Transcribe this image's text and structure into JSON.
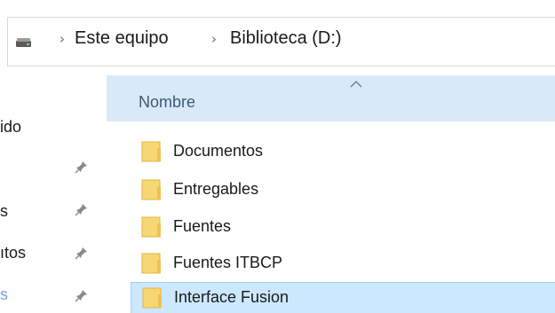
{
  "address_bar": {
    "drive_icon": "drive-icon",
    "breadcrumbs": [
      "Este equipo",
      "Biblioteca (D:)"
    ],
    "separator": "›"
  },
  "nav_pane": {
    "items": [
      {
        "label": "ido",
        "pinned": false
      },
      {
        "label": "",
        "pinned": true
      },
      {
        "label": "s",
        "pinned": true
      },
      {
        "label": "ıtos",
        "pinned": true
      },
      {
        "label": "s",
        "pinned": true
      }
    ]
  },
  "columns": {
    "name_header": "Nombre",
    "sort_indicator": "caret-up-icon"
  },
  "files": [
    {
      "name": "Documentos",
      "type": "folder",
      "selected": false
    },
    {
      "name": "Entregables",
      "type": "folder",
      "selected": false
    },
    {
      "name": "Fuentes",
      "type": "folder",
      "selected": false
    },
    {
      "name": "Fuentes ITBCP",
      "type": "folder",
      "selected": false
    },
    {
      "name": "Interface Fusion",
      "type": "folder",
      "selected": true
    }
  ],
  "colors": {
    "header_bg": "#d9e9f7",
    "selection_bg": "#cce8ff",
    "selection_border": "#99d1ff",
    "folder_yellow": "#f7d774"
  }
}
